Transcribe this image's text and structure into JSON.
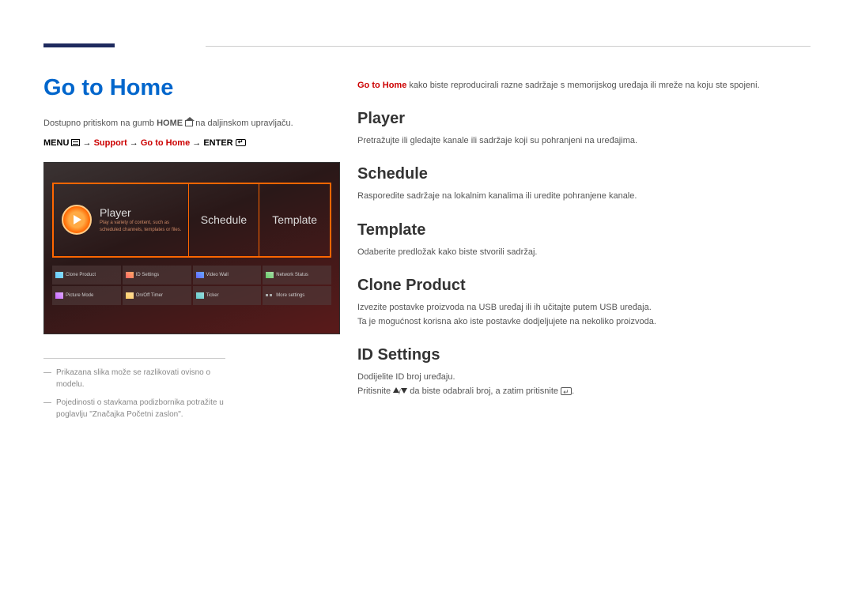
{
  "pageTitle": "Go to Home",
  "intro": {
    "pre": "Dostupno pritiskom na gumb ",
    "homeBold": "HOME",
    "post": " na daljinskom upravljaču."
  },
  "menuPath": {
    "menu": "MENU",
    "arrow": " → ",
    "support": "Support",
    "goToHome": "Go to Home",
    "enter": "ENTER"
  },
  "screenshot": {
    "tiles": {
      "player": "Player",
      "playerSub1": "Play a variety of content, such as",
      "playerSub2": "scheduled channels, templates or files.",
      "schedule": "Schedule",
      "template": "Template"
    },
    "grid": [
      "Clone Product",
      "ID Settings",
      "Video Wall",
      "Network Status",
      "Picture Mode",
      "On/Off Timer",
      "Ticker",
      "More settings"
    ]
  },
  "notes": [
    "Prikazana slika može se razlikovati ovisno o modelu.",
    "Pojedinosti o stavkama podizbornika potražite u poglavlju \"Značajka Početni zaslon\"."
  ],
  "right": {
    "firstBoldRed": "Go to Home",
    "firstRest": " kako biste reproducirali razne sadržaje s memorijskog uređaja ili mreže na koju ste spojeni.",
    "sections": {
      "player": {
        "title": "Player",
        "text": "Pretražujte ili gledajte kanale ili sadržaje koji su pohranjeni na uređajima."
      },
      "schedule": {
        "title": "Schedule",
        "text": "Rasporedite sadržaje na lokalnim kanalima ili uredite pohranjene kanale."
      },
      "template": {
        "title": "Template",
        "text": "Odaberite predložak kako biste stvorili sadržaj."
      },
      "cloneProduct": {
        "title": "Clone Product",
        "text1": "Izvezite postavke proizvoda na USB uređaj ili ih učitajte putem USB uređaja.",
        "text2": "Ta je mogućnost korisna ako iste postavke dodjeljujete na nekoliko proizvoda."
      },
      "idSettings": {
        "title": "ID Settings",
        "text1": "Dodijelite ID broj uređaju.",
        "text2Pre": "Pritisnite ",
        "text2Mid": " da biste odabrali broj, a zatim pritisnite ",
        "text2Post": "."
      }
    }
  }
}
